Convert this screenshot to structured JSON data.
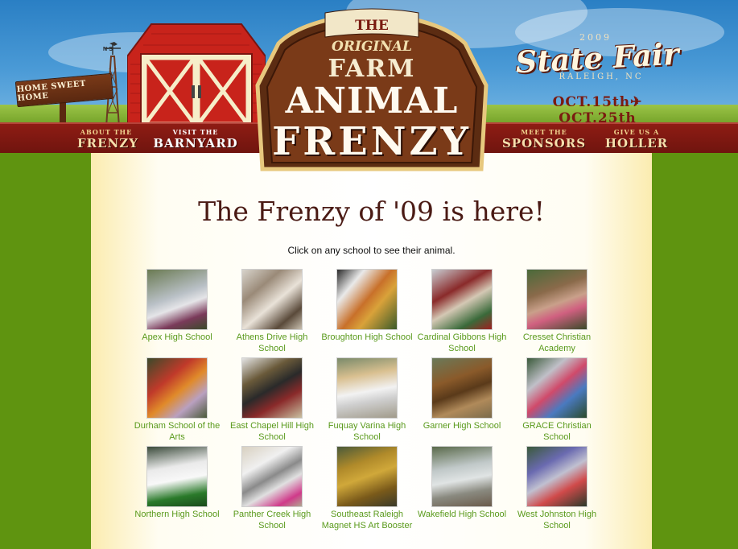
{
  "header": {
    "sign_text": "HOME SWEET HOME",
    "windmill_letters": "N·S",
    "logo": {
      "line1": "THE",
      "line2": "ORIGINAL",
      "line3": "FARM",
      "line4": "ANIMAL",
      "line5": "FRENZY"
    },
    "state_fair": {
      "year": "2009",
      "name": "State Fair",
      "city": "RALEIGH, NC",
      "dates": "OCT.15th✈OCT.25th"
    },
    "nav": [
      {
        "small": "About the",
        "big": "Frenzy"
      },
      {
        "small": "Visit the",
        "big": "Barnyard"
      },
      {
        "small": "Meet the",
        "big": "Sponsors"
      },
      {
        "small": "Give us a",
        "big": "Holler"
      }
    ]
  },
  "main": {
    "title": "The Frenzy of '09 is here!",
    "intro": "Click on any school to see their animal.",
    "schools": [
      {
        "name": "Apex High School"
      },
      {
        "name": "Athens Drive High School"
      },
      {
        "name": "Broughton High School"
      },
      {
        "name": "Cardinal Gibbons High School"
      },
      {
        "name": "Cresset Christian Academy"
      },
      {
        "name": "Durham School of the Arts"
      },
      {
        "name": "East Chapel Hill High School"
      },
      {
        "name": "Fuquay Varina High School"
      },
      {
        "name": "Garner High School"
      },
      {
        "name": "GRACE Christian School"
      },
      {
        "name": "Northern High School"
      },
      {
        "name": "Panther Creek High School"
      },
      {
        "name": "Southeast Raleigh Magnet HS Art Booster"
      },
      {
        "name": "Wakefield High School"
      },
      {
        "name": "West Johnston High School"
      }
    ]
  },
  "colors": {
    "link": "#5a9a1c",
    "title": "#4a1a14",
    "nav_bar": "#8e1c14",
    "side_green": "#5f9410"
  }
}
